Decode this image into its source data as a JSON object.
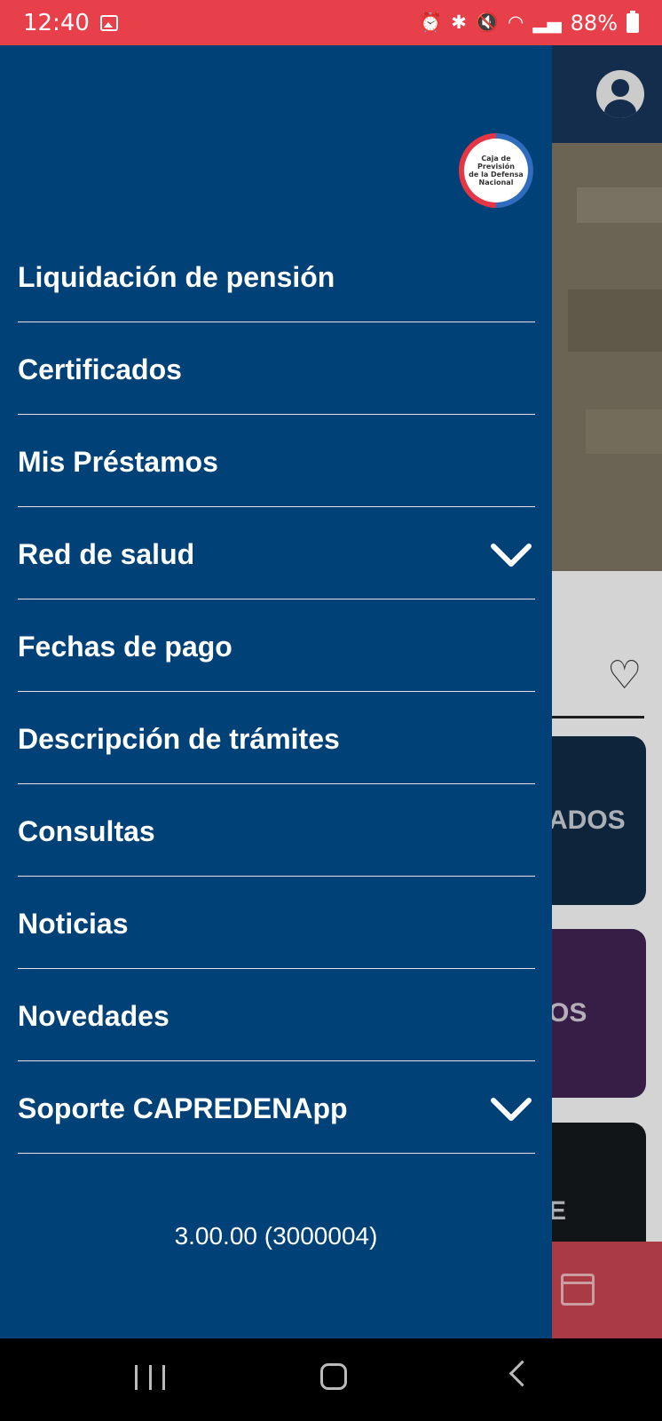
{
  "status_bar": {
    "time": "12:40",
    "battery": "88%",
    "icons": [
      "image-icon",
      "alarm-icon",
      "bluetooth-icon",
      "mute-icon",
      "wifi-icon",
      "signal-icon",
      "battery-icon"
    ]
  },
  "logo": {
    "line1": "Caja de",
    "line2": "Previsión",
    "line3": "de la Defensa",
    "line4": "Nacional"
  },
  "menu": {
    "items": [
      {
        "label": "Liquidación de pensión"
      },
      {
        "label": "Certificados"
      },
      {
        "label": "Mis Préstamos"
      },
      {
        "label": "Red de salud",
        "expandable": true
      },
      {
        "label": "Fechas de pago"
      },
      {
        "label": "Descripción de trámites"
      },
      {
        "label": "Consultas"
      },
      {
        "label": "Noticias"
      },
      {
        "label": "Novedades"
      },
      {
        "label": "Soporte CAPREDENApp",
        "expandable": true
      }
    ]
  },
  "version": "3.00.00 (3000004)",
  "background": {
    "card1_text": "ADOS",
    "card2_text": "OS",
    "card3_text": "E"
  },
  "colors": {
    "drawer": "#004178",
    "status_bar": "#e8404b",
    "header": "#173457"
  }
}
